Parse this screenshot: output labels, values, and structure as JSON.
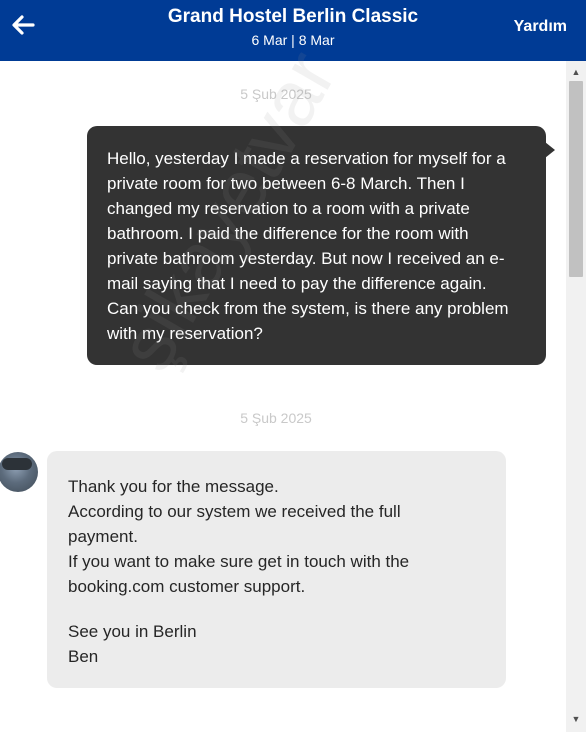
{
  "header": {
    "title": "Grand Hostel Berlin Classic",
    "dates": "6 Mar | 8 Mar",
    "help_label": "Yardım",
    "back_icon": "arrow-left-icon"
  },
  "messages": [
    {
      "date": "5 Şub 2025",
      "direction": "outgoing",
      "lines": [
        "Hello, yesterday I made a reservation for myself for a",
        "private room for two between 6-8 March. Then I",
        "changed my reservation to a room with a private",
        "bathroom. I paid the difference for the room with",
        "private bathroom yesterday. But now I received an e-",
        "mail saying that I need to pay the difference again.",
        "Can you check from the system, is there any problem",
        "with my reservation?"
      ]
    },
    {
      "date": "5 Şub 2025",
      "direction": "incoming",
      "lines": [
        "Thank you for the message.",
        "According to our system we received the full",
        "payment.",
        "If you want to make sure get in touch with the",
        "booking.com customer support."
      ],
      "signoff": [
        "See you in Berlin",
        "Ben"
      ]
    }
  ],
  "watermark": "şikayetvar",
  "colors": {
    "header_bg": "#003b95",
    "outgoing_bubble": "#333333",
    "incoming_bubble": "#ececec"
  }
}
